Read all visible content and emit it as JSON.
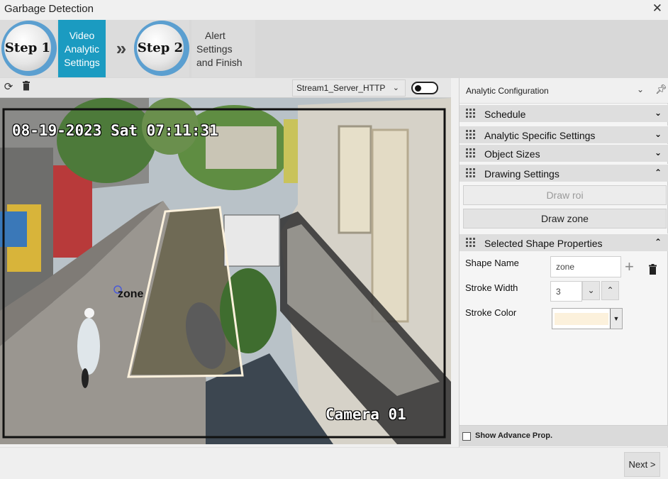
{
  "window": {
    "title": "Garbage Detection",
    "close_icon": "close-icon"
  },
  "steps": {
    "step1": {
      "badge": "Step 1",
      "label_lines": [
        "Video",
        "Analytic",
        "Settings"
      ]
    },
    "arrow": "»",
    "step2": {
      "badge": "Step 2",
      "label_lines": [
        "Alert",
        "Settings",
        "and Finish"
      ]
    },
    "active_color": "#1b9bc1",
    "ring_color": "#5b9fd0"
  },
  "video_toolbar": {
    "refresh_icon": "refresh-icon",
    "delete_icon": "trash-icon",
    "stream": "Stream1_Server_HTTP",
    "toggle_on": false
  },
  "video": {
    "timestamp": "08-19-2023 Sat 07:11:31",
    "camera_label": "Camera 01",
    "zone_label": "zone",
    "zone_stroke_color": "#fcf1dc"
  },
  "panel": {
    "title": "Analytic Configuration",
    "sections": {
      "schedule": "Schedule",
      "analytic_specific": "Analytic Specific Settings",
      "object_sizes": "Object Sizes",
      "drawing_settings": "Drawing Settings",
      "selected_shape": "Selected Shape Properties"
    },
    "draw_roi": "Draw roi",
    "draw_zone": "Draw zone",
    "properties": {
      "shape_name_label": "Shape Name",
      "shape_name_value": "zone",
      "stroke_width_label": "Stroke Width",
      "stroke_width_value": "3",
      "stroke_color_label": "Stroke Color",
      "stroke_color_value": "#fcf1dc"
    },
    "advance_label": "Show Advance Prop."
  },
  "footer": {
    "next_label": "Next >"
  }
}
